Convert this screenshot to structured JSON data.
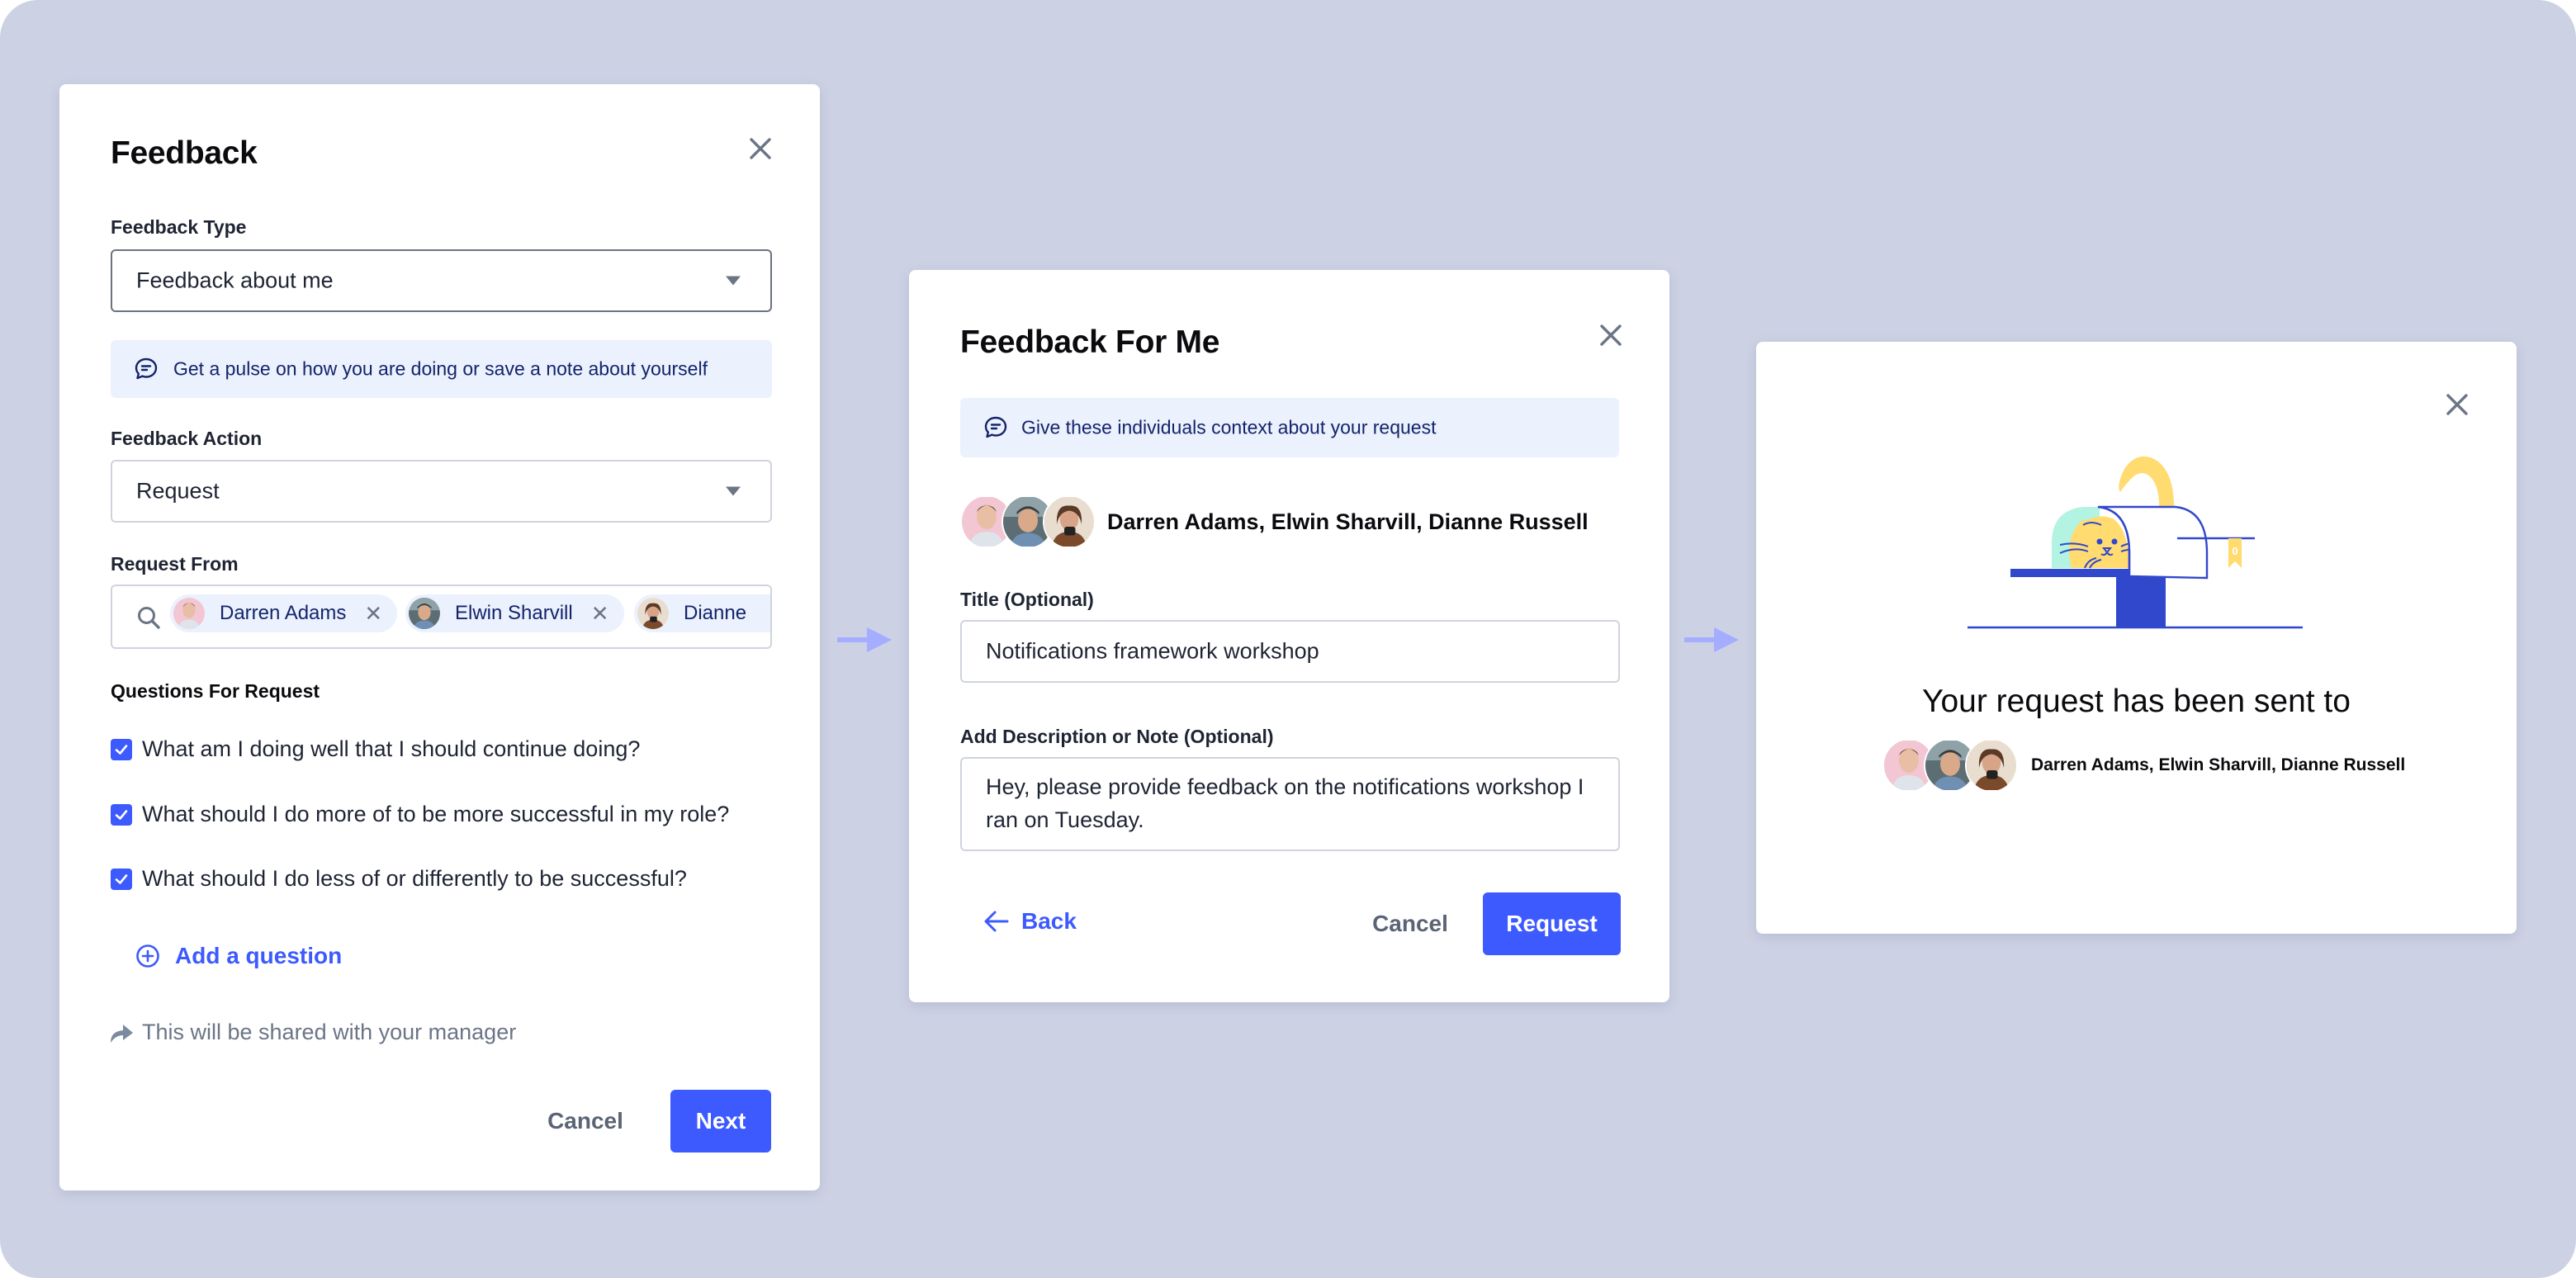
{
  "colors": {
    "background": "#CDD1E4",
    "primary": "#3D5AFE",
    "info_bg": "#EBF1FD",
    "info_text": "#13246b",
    "muted": "#6b7586",
    "arrow": "#A4ADFF"
  },
  "panel1": {
    "title": "Feedback",
    "close_icon": "close-icon",
    "feedback_type": {
      "label": "Feedback Type",
      "value": "Feedback about me"
    },
    "info": {
      "icon": "chat-bubble-icon",
      "text": "Get a pulse on how you are doing or save a note about yourself"
    },
    "feedback_action": {
      "label": "Feedback Action",
      "value": "Request"
    },
    "request_from": {
      "label": "Request From",
      "search_icon": "search-icon",
      "chips": [
        {
          "name": "Darren Adams",
          "removable": true
        },
        {
          "name": "Elwin Sharvill",
          "removable": true
        },
        {
          "name": "Dianne",
          "removable": false
        }
      ],
      "remove_glyph": "✕"
    },
    "questions": {
      "label": "Questions For Request",
      "items": [
        {
          "text": "What am I doing well that I should continue doing?",
          "checked": true
        },
        {
          "text": "What should I do more of to be more successful in my role?",
          "checked": true
        },
        {
          "text": "What should I do less of or differently to be successful?",
          "checked": true
        }
      ],
      "add_label": "Add a question"
    },
    "share_notice": "This will be shared with your manager",
    "cancel_label": "Cancel",
    "next_label": "Next"
  },
  "panel2": {
    "title": "Feedback For Me",
    "info": {
      "text": "Give these individuals context about your request"
    },
    "recipients": "Darren Adams, Elwin Sharvill, Dianne Russell",
    "title_field": {
      "label": "Title (Optional)",
      "value": "Notifications framework workshop"
    },
    "description_field": {
      "label": "Add Description or Note (Optional)",
      "value": "Hey, please provide feedback on the notifications workshop I ran on Tuesday."
    },
    "back_label": "Back",
    "cancel_label": "Cancel",
    "request_label": "Request"
  },
  "panel3": {
    "heading": "Your request has been sent to",
    "recipients": "Darren Adams, Elwin Sharvill, Dianne Russell",
    "mailbox_flag_count": "0"
  }
}
